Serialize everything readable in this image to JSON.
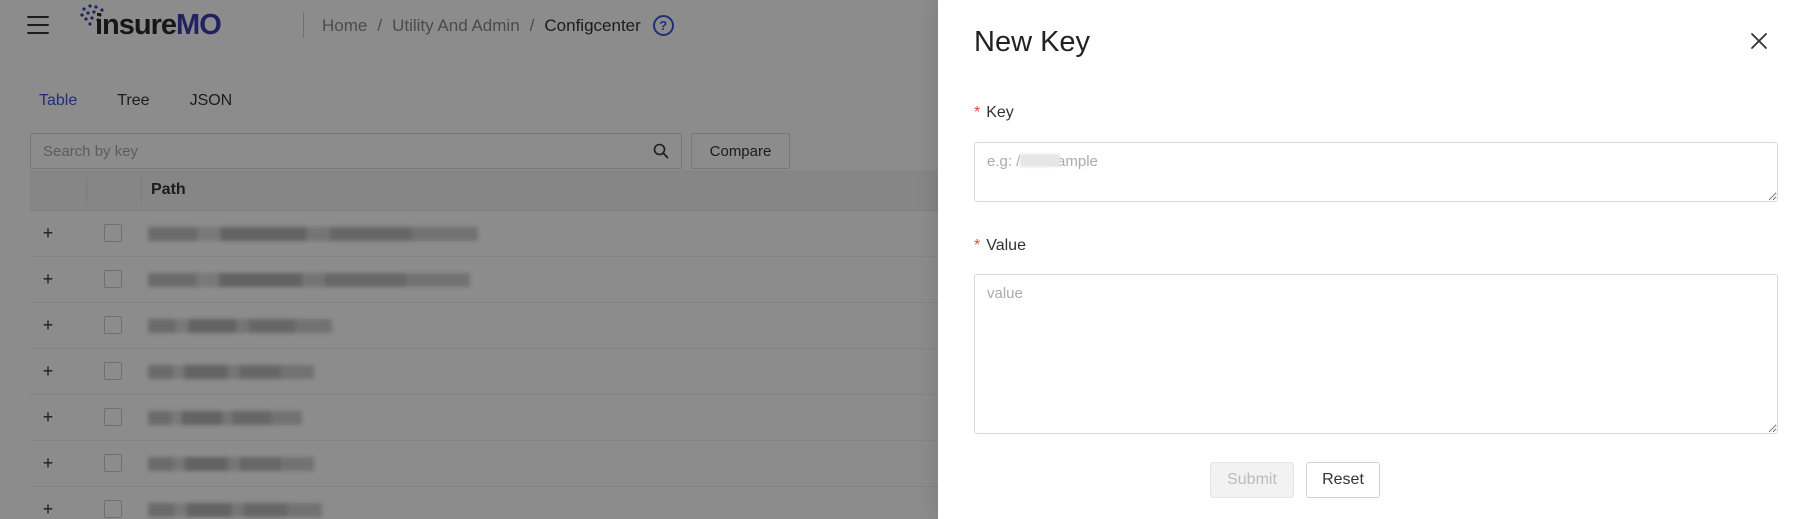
{
  "header": {
    "logo_text_a": "insure",
    "logo_text_b": "MO",
    "breadcrumb": [
      "Home",
      "Utility And Admin",
      "Configcenter"
    ],
    "breadcrumb_sep": "/",
    "help_glyph": "?"
  },
  "tabs": [
    {
      "label": "Table",
      "active": true
    },
    {
      "label": "Tree",
      "active": false
    },
    {
      "label": "JSON",
      "active": false
    }
  ],
  "search": {
    "placeholder": "Search by key"
  },
  "compare_label": "Compare",
  "table": {
    "path_header": "Path",
    "expand_glyph": "+",
    "row_count": 7
  },
  "drawer": {
    "title": "New Key",
    "key_label": "Key",
    "key_placeholder": "e.g: /      /sample",
    "value_label": "Value",
    "value_placeholder": "value",
    "required_mark": "*",
    "submit_label": "Submit",
    "reset_label": "Reset"
  },
  "colors": {
    "accent": "#3b57d8",
    "required": "#e54545",
    "overlay": "rgba(0,0,0,0.45)"
  },
  "icons": [
    "menu-icon",
    "help-icon",
    "search-icon",
    "close-icon"
  ]
}
